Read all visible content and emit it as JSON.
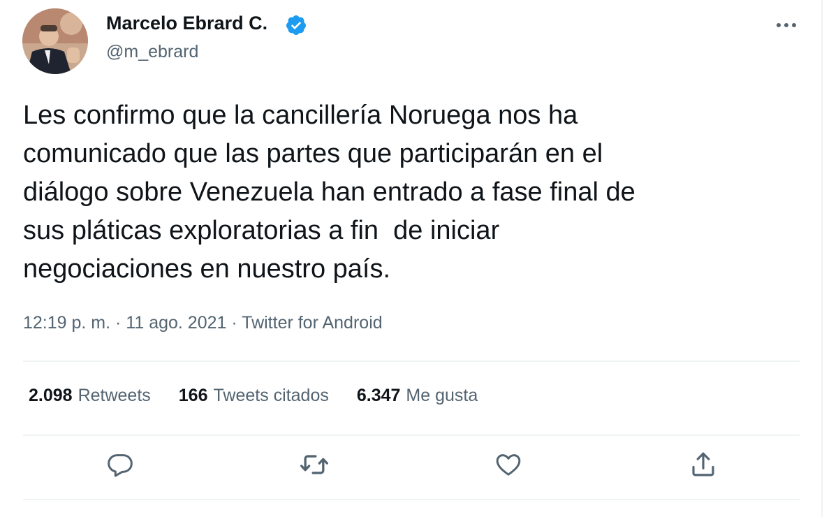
{
  "author": {
    "name": "Marcelo Ebrard C.",
    "handle": "@m_ebrard",
    "verified": true
  },
  "tweet": {
    "text_lines": [
      "Les confirmo que la cancillería Noruega nos ha",
      "comunicado que las partes que participarán en el",
      "diálogo sobre Venezuela han entrado a fase final de",
      "sus pláticas exploratorias a fin  de iniciar",
      "negociaciones en nuestro país."
    ],
    "meta": "12:19 p. m. · 11 ago. 2021 · Twitter for Android"
  },
  "stats": {
    "retweets": {
      "count": "2.098",
      "label": "Retweets"
    },
    "quotes": {
      "count": "166",
      "label": "Tweets citados"
    },
    "likes": {
      "count": "6.347",
      "label": "Me gusta"
    }
  },
  "icons": {
    "more": "more-icon",
    "reply": "reply-icon",
    "retweet": "retweet-icon",
    "like": "like-icon",
    "share": "share-icon",
    "verified": "verified-badge-icon"
  },
  "colors": {
    "text": "#0f1419",
    "secondary": "#536471",
    "verified": "#1d9bf0",
    "divider": "#eff3f4"
  }
}
